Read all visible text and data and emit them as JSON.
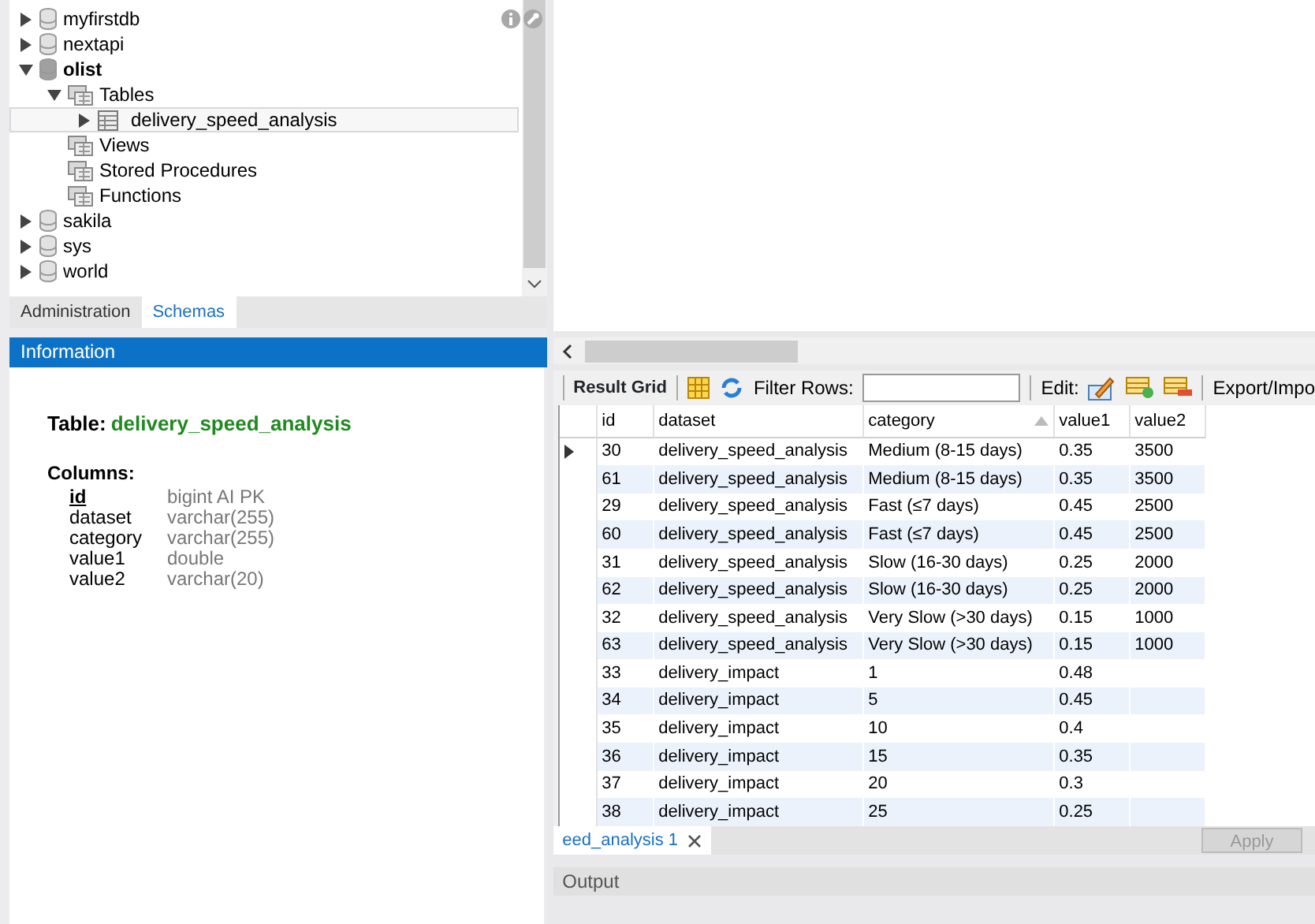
{
  "schema_tree": {
    "items": [
      {
        "label": "myfirstdb",
        "kind": "schema",
        "expandable": true,
        "expanded": false,
        "active": false,
        "selected": false
      },
      {
        "label": "nextapi",
        "kind": "schema",
        "expandable": true,
        "expanded": false,
        "active": false,
        "selected": false
      },
      {
        "label": "olist",
        "kind": "schema",
        "expandable": true,
        "expanded": true,
        "active": true,
        "selected": false,
        "children": [
          {
            "label": "Tables",
            "kind": "folder",
            "expandable": true,
            "expanded": true,
            "selected": false,
            "children": [
              {
                "label": "delivery_speed_analysis",
                "kind": "table",
                "expandable": true,
                "expanded": false,
                "selected": true
              }
            ]
          },
          {
            "label": "Views",
            "kind": "folder",
            "expandable": false,
            "expanded": false,
            "selected": false
          },
          {
            "label": "Stored Procedures",
            "kind": "folder",
            "expandable": false,
            "expanded": false,
            "selected": false
          },
          {
            "label": "Functions",
            "kind": "folder",
            "expandable": false,
            "expanded": false,
            "selected": false
          }
        ]
      },
      {
        "label": "sakila",
        "kind": "schema",
        "expandable": true,
        "expanded": false,
        "active": false,
        "selected": false
      },
      {
        "label": "sys",
        "kind": "schema",
        "expandable": true,
        "expanded": false,
        "active": false,
        "selected": false
      },
      {
        "label": "world",
        "kind": "schema",
        "expandable": true,
        "expanded": false,
        "active": false,
        "selected": false
      }
    ]
  },
  "sidebar_tabs": [
    {
      "label": "Administration",
      "selected": false
    },
    {
      "label": "Schemas",
      "selected": true
    }
  ],
  "info_panel": {
    "title": "Information",
    "table_label": "Table:",
    "table_name": "delivery_speed_analysis",
    "columns_label": "Columns:",
    "columns": [
      {
        "name": "id",
        "type": "bigint AI PK",
        "primary_key": true
      },
      {
        "name": "dataset",
        "type": "varchar(255)",
        "primary_key": false
      },
      {
        "name": "category",
        "type": "varchar(255)",
        "primary_key": false
      },
      {
        "name": "value1",
        "type": "double",
        "primary_key": false
      },
      {
        "name": "value2",
        "type": "varchar(20)",
        "primary_key": false
      }
    ]
  },
  "result_toolbar": {
    "result_grid_label": "Result Grid",
    "filter_label": "Filter Rows:",
    "edit_label": "Edit:",
    "export_label": "Export/Impo"
  },
  "result_grid": {
    "columns": [
      {
        "label": "id",
        "sorted": false
      },
      {
        "label": "dataset",
        "sorted": false
      },
      {
        "label": "category",
        "sorted": true
      },
      {
        "label": "value1",
        "sorted": false
      },
      {
        "label": "value2",
        "sorted": false
      }
    ],
    "rows": [
      {
        "current": true,
        "cells": [
          "30",
          "delivery_speed_analysis",
          "Medium (8-15 days)",
          "0.35",
          "3500"
        ]
      },
      {
        "current": false,
        "cells": [
          "61",
          "delivery_speed_analysis",
          "Medium (8-15 days)",
          "0.35",
          "3500"
        ]
      },
      {
        "current": false,
        "cells": [
          "29",
          "delivery_speed_analysis",
          "Fast (≤7 days)",
          "0.45",
          "2500"
        ]
      },
      {
        "current": false,
        "cells": [
          "60",
          "delivery_speed_analysis",
          "Fast (≤7 days)",
          "0.45",
          "2500"
        ]
      },
      {
        "current": false,
        "cells": [
          "31",
          "delivery_speed_analysis",
          "Slow (16-30 days)",
          "0.25",
          "2000"
        ]
      },
      {
        "current": false,
        "cells": [
          "62",
          "delivery_speed_analysis",
          "Slow (16-30 days)",
          "0.25",
          "2000"
        ]
      },
      {
        "current": false,
        "cells": [
          "32",
          "delivery_speed_analysis",
          "Very Slow (>30 days)",
          "0.15",
          "1000"
        ]
      },
      {
        "current": false,
        "cells": [
          "63",
          "delivery_speed_analysis",
          "Very Slow (>30 days)",
          "0.15",
          "1000"
        ]
      },
      {
        "current": false,
        "cells": [
          "33",
          "delivery_impact",
          "1",
          "0.48",
          ""
        ]
      },
      {
        "current": false,
        "cells": [
          "34",
          "delivery_impact",
          "5",
          "0.45",
          ""
        ]
      },
      {
        "current": false,
        "cells": [
          "35",
          "delivery_impact",
          "10",
          "0.4",
          ""
        ]
      },
      {
        "current": false,
        "cells": [
          "36",
          "delivery_impact",
          "15",
          "0.35",
          ""
        ]
      },
      {
        "current": false,
        "cells": [
          "37",
          "delivery_impact",
          "20",
          "0.3",
          ""
        ]
      },
      {
        "current": false,
        "cells": [
          "38",
          "delivery_impact",
          "25",
          "0.25",
          ""
        ]
      }
    ]
  },
  "result_tabs": [
    {
      "label": "eed_analysis 1",
      "selected": true
    }
  ],
  "apply_button": {
    "label": "Apply",
    "disabled": true
  },
  "output_panel": {
    "title": "Output"
  }
}
